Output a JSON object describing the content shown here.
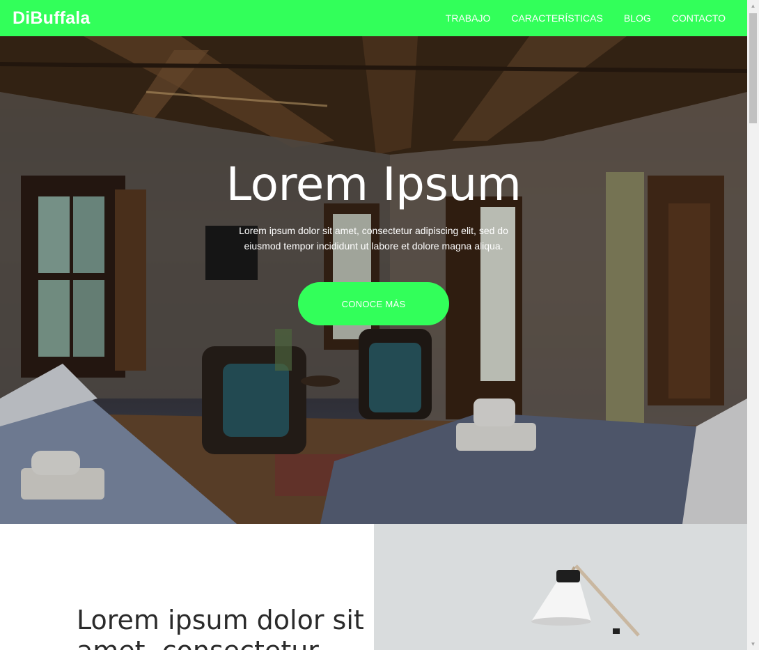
{
  "brand": "DiBuffala",
  "nav": {
    "items": [
      "TRABAJO",
      "CARACTERÍSTICAS",
      "BLOG",
      "CONTACTO"
    ]
  },
  "hero": {
    "title": "Lorem Ipsum",
    "text": "Lorem ipsum dolor sit amet, consectetur adipiscing elit, sed do eiusmod tempor incididunt ut labore et dolore magna aliqua.",
    "button_label": "CONOCE MÁS"
  },
  "section2": {
    "heading": "Lorem ipsum dolor sit amet, consectetur"
  },
  "colors": {
    "accent": "#32ff5a",
    "text_dark": "#2b2b2b"
  }
}
